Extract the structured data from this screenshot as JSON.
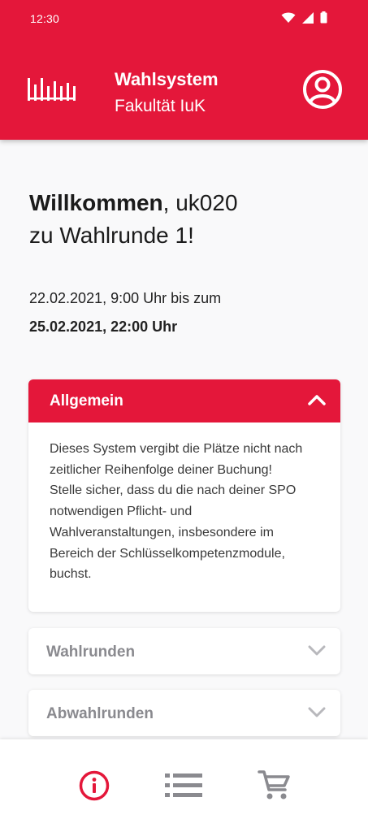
{
  "status_bar": {
    "time": "12:30"
  },
  "app_bar": {
    "title": "Wahlsystem",
    "subtitle": "Fakultät IuK",
    "logo_icon": "university-logo-icon",
    "profile_icon": "account-circle-icon"
  },
  "welcome": {
    "greeting_bold": "Willkommen",
    "greeting_rest": ", uk020",
    "line2": "zu Wahlrunde 1!"
  },
  "period": {
    "start": "22.02.2021, 9:00 Uhr bis zum",
    "end": "25.02.2021, 22:00 Uhr"
  },
  "accordions": [
    {
      "label": "Allgemein",
      "expanded": true,
      "body": "Dieses System vergibt die Plätze nicht nach\nzeitlicher Reihenfolge deiner  Buchung!\nStelle sicher, dass du die nach deiner SPO\nnotwendigen Pflicht- und\nWahlveranstaltungen, insbesondere im\nBereich der Schlüsselkompetenzmodule,\nbuchst."
    },
    {
      "label": "Wahlrunden",
      "expanded": false
    },
    {
      "label": "Abwahlrunden",
      "expanded": false
    }
  ],
  "bottom_nav": [
    {
      "icon": "info-icon",
      "active": true
    },
    {
      "icon": "list-icon",
      "active": false
    },
    {
      "icon": "cart-icon",
      "active": false
    }
  ],
  "colors": {
    "brand_red": "#e4173a",
    "inactive_gray": "#8a8a8f",
    "background": "#f9f9fa"
  }
}
